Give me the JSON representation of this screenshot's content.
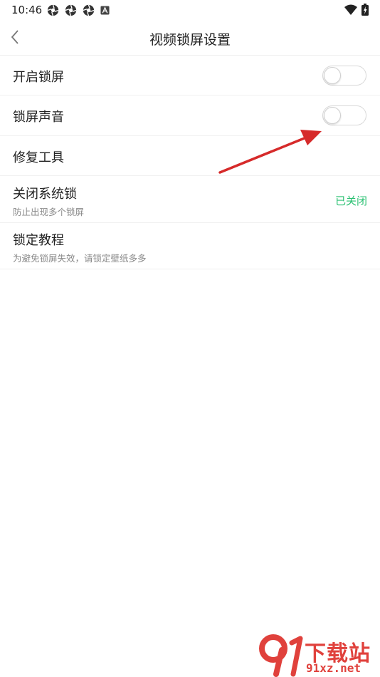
{
  "status_bar": {
    "time": "10:46",
    "left_icons": [
      "aperture-icon",
      "aperture-icon",
      "aperture-icon",
      "a-box-icon"
    ],
    "right_icons": [
      "wifi-icon",
      "battery-charging-icon"
    ]
  },
  "header": {
    "title": "视频锁屏设置",
    "back_icon": "chevron-left-icon"
  },
  "settings": {
    "enable_lock": {
      "label": "开启锁屏",
      "toggle_on": false
    },
    "lock_sound": {
      "label": "锁屏声音",
      "toggle_on": false
    },
    "repair_tool": {
      "label": "修复工具"
    },
    "close_system_lock": {
      "label": "关闭系统锁",
      "sub": "防止出现多个锁屏",
      "status": "已关闭"
    },
    "lock_tutorial": {
      "label": "锁定教程",
      "sub": "为避免锁屏失效，请锁定壁纸多多"
    }
  },
  "watermark": {
    "logo_text": "下载站",
    "domain_text": "91xz.net"
  },
  "colors": {
    "accent_green": "#29c071",
    "annotation_red": "#d62a2a",
    "watermark_red": "#e0413c"
  }
}
